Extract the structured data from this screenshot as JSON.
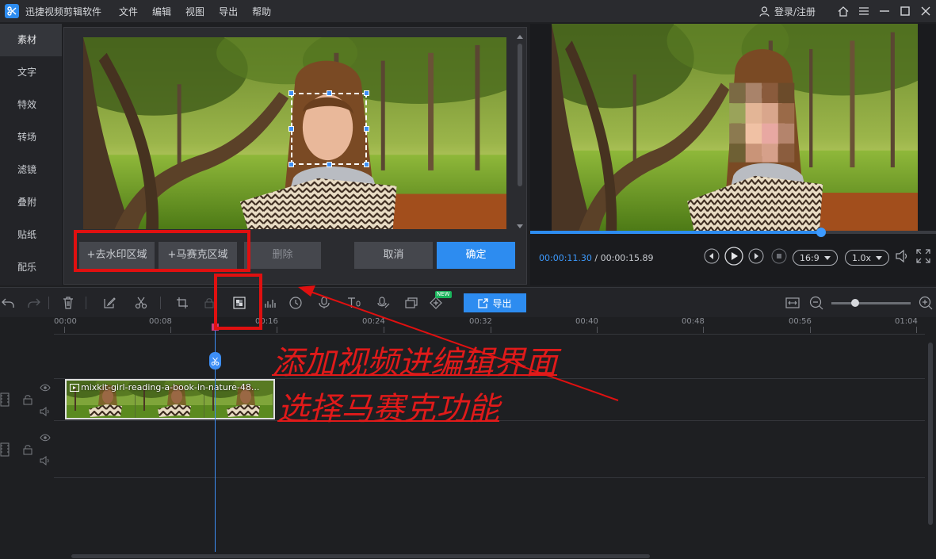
{
  "app": {
    "title": "迅捷视频剪辑软件",
    "menu": [
      "文件",
      "编辑",
      "视图",
      "导出",
      "帮助"
    ],
    "login_label": "登录/注册"
  },
  "sidebar": {
    "items": [
      {
        "label": "素材",
        "active": true
      },
      {
        "label": "文字",
        "active": false
      },
      {
        "label": "特效",
        "active": false
      },
      {
        "label": "转场",
        "active": false
      },
      {
        "label": "滤镜",
        "active": false
      },
      {
        "label": "叠附",
        "active": false
      },
      {
        "label": "贴纸",
        "active": false
      },
      {
        "label": "配乐",
        "active": false
      }
    ]
  },
  "editor": {
    "add_watermark_area": "+去水印区域",
    "add_mosaic_area": "+马赛克区域",
    "delete_label": "删除",
    "cancel_label": "取消",
    "confirm_label": "确定"
  },
  "preview": {
    "current_time": "00:00:11.30",
    "separator": " / ",
    "total_time": "00:00:15.89",
    "progress_fraction": 0.717,
    "aspect_ratio": "16:9",
    "speed": "1.0x"
  },
  "toolbar": {
    "export_label": "导出",
    "new_badge": "NEW",
    "zoom_fraction": 0.3
  },
  "timeline": {
    "ticks": [
      "00:00",
      "00:08",
      "00:16",
      "00:24",
      "00:32",
      "00:40",
      "00:48",
      "00:56",
      "01:04"
    ],
    "clip_name": "mixkit-girl-reading-a-book-in-nature-48..."
  },
  "annotations": {
    "line1": "添加视频进编辑界面",
    "line2": "选择马赛克功能",
    "color": "#e01010"
  },
  "colors": {
    "accent": "#2d8cf0",
    "background": "#1e1f22",
    "panel": "#2b2c30"
  }
}
